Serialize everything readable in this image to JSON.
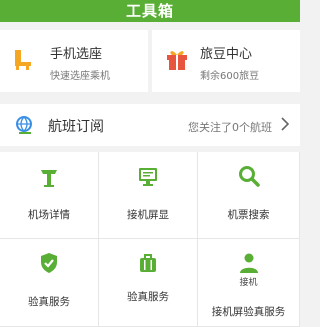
{
  "header": {
    "title": "工具箱"
  },
  "cards": [
    {
      "title": "手机选座",
      "subtitle": "快速选座乘机",
      "icon": "seat-icon"
    },
    {
      "title": "旅豆中心",
      "subtitle": "剩余600旅豆",
      "icon": "gift-icon"
    }
  ],
  "subscription": {
    "title": "航班订阅",
    "hint": "您关注了0个航班",
    "icon": "globe-icon"
  },
  "grid": [
    {
      "label": "机场详情",
      "icon": "control-tower-icon"
    },
    {
      "label": "接机屏显",
      "icon": "monitor-icon"
    },
    {
      "label": "机票搜索",
      "icon": "search-icon"
    },
    {
      "label": "验真服务",
      "icon": "shield-check-icon"
    },
    {
      "label": "验真服务",
      "icon": "luggage-icon"
    },
    {
      "label": "接机屏验真服务",
      "label_top": "接机",
      "icon": "person-icon"
    }
  ],
  "colors": {
    "brand": "#59ae36",
    "accent_orange": "#f5a623",
    "gift_red": "#e8553e"
  }
}
